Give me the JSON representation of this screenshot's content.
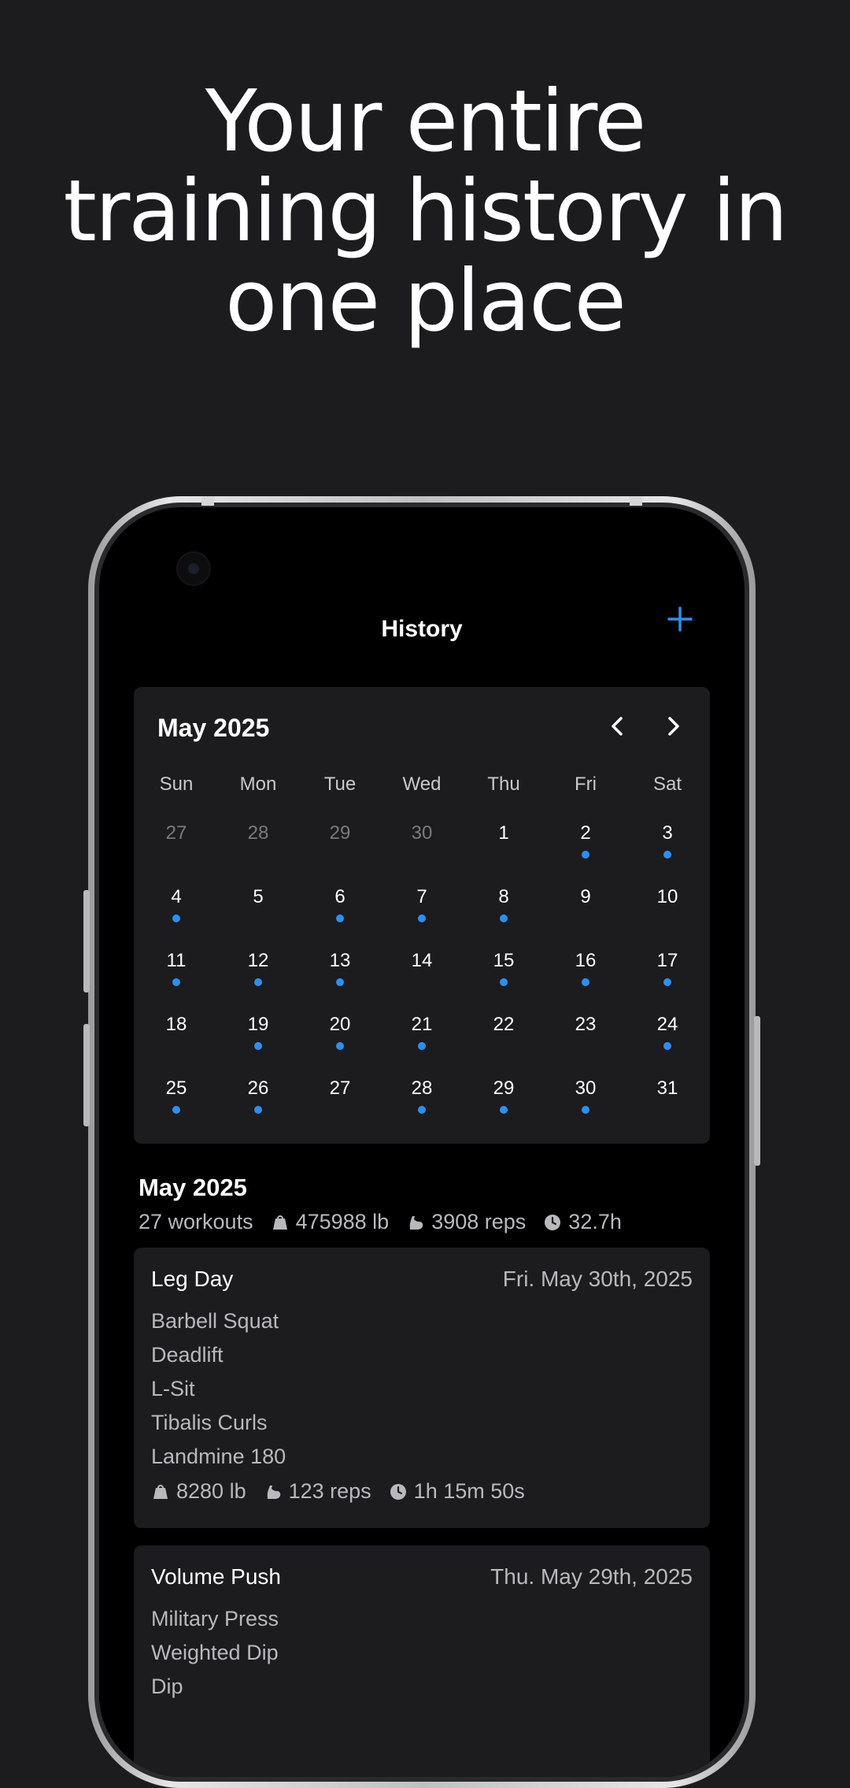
{
  "headline": {
    "line1": "Your entire",
    "line2": "training history in",
    "line3": "one place"
  },
  "app": {
    "title": "History",
    "add_icon": "plus-icon",
    "accent_color": "#2d8ff0"
  },
  "calendar": {
    "month_label": "May 2025",
    "prev_icon": "chevron-left-icon",
    "next_icon": "chevron-right-icon",
    "weekdays": [
      "Sun",
      "Mon",
      "Tue",
      "Wed",
      "Thu",
      "Fri",
      "Sat"
    ],
    "weeks": [
      [
        {
          "d": "27",
          "muted": true,
          "dot": false
        },
        {
          "d": "28",
          "muted": true,
          "dot": false
        },
        {
          "d": "29",
          "muted": true,
          "dot": false
        },
        {
          "d": "30",
          "muted": true,
          "dot": false
        },
        {
          "d": "1",
          "muted": false,
          "dot": false
        },
        {
          "d": "2",
          "muted": false,
          "dot": true
        },
        {
          "d": "3",
          "muted": false,
          "dot": true
        }
      ],
      [
        {
          "d": "4",
          "muted": false,
          "dot": true
        },
        {
          "d": "5",
          "muted": false,
          "dot": false
        },
        {
          "d": "6",
          "muted": false,
          "dot": true
        },
        {
          "d": "7",
          "muted": false,
          "dot": true
        },
        {
          "d": "8",
          "muted": false,
          "dot": true
        },
        {
          "d": "9",
          "muted": false,
          "dot": false
        },
        {
          "d": "10",
          "muted": false,
          "dot": false
        }
      ],
      [
        {
          "d": "11",
          "muted": false,
          "dot": true
        },
        {
          "d": "12",
          "muted": false,
          "dot": true
        },
        {
          "d": "13",
          "muted": false,
          "dot": true
        },
        {
          "d": "14",
          "muted": false,
          "dot": false
        },
        {
          "d": "15",
          "muted": false,
          "dot": true
        },
        {
          "d": "16",
          "muted": false,
          "dot": true
        },
        {
          "d": "17",
          "muted": false,
          "dot": true
        }
      ],
      [
        {
          "d": "18",
          "muted": false,
          "dot": false
        },
        {
          "d": "19",
          "muted": false,
          "dot": true
        },
        {
          "d": "20",
          "muted": false,
          "dot": true
        },
        {
          "d": "21",
          "muted": false,
          "dot": true
        },
        {
          "d": "22",
          "muted": false,
          "dot": false
        },
        {
          "d": "23",
          "muted": false,
          "dot": false
        },
        {
          "d": "24",
          "muted": false,
          "dot": true
        }
      ],
      [
        {
          "d": "25",
          "muted": false,
          "dot": true
        },
        {
          "d": "26",
          "muted": false,
          "dot": true
        },
        {
          "d": "27",
          "muted": false,
          "dot": false
        },
        {
          "d": "28",
          "muted": false,
          "dot": true
        },
        {
          "d": "29",
          "muted": false,
          "dot": true
        },
        {
          "d": "30",
          "muted": false,
          "dot": true
        },
        {
          "d": "31",
          "muted": false,
          "dot": false
        }
      ]
    ]
  },
  "summary": {
    "title": "May 2025",
    "workouts": "27 workouts",
    "weight": "475988 lb",
    "reps": "3908 reps",
    "duration": "32.7h"
  },
  "workouts": [
    {
      "title": "Leg Day",
      "date": "Fri. May 30th, 2025",
      "exercises": [
        "Barbell Squat",
        "Deadlift",
        "L-Sit",
        "Tibalis Curls",
        "Landmine 180"
      ],
      "weight": "8280 lb",
      "reps": "123 reps",
      "duration": "1h 15m 50s"
    },
    {
      "title": "Volume Push",
      "date": "Thu. May 29th, 2025",
      "exercises": [
        "Military Press",
        "Weighted Dip",
        "Dip"
      ]
    }
  ]
}
